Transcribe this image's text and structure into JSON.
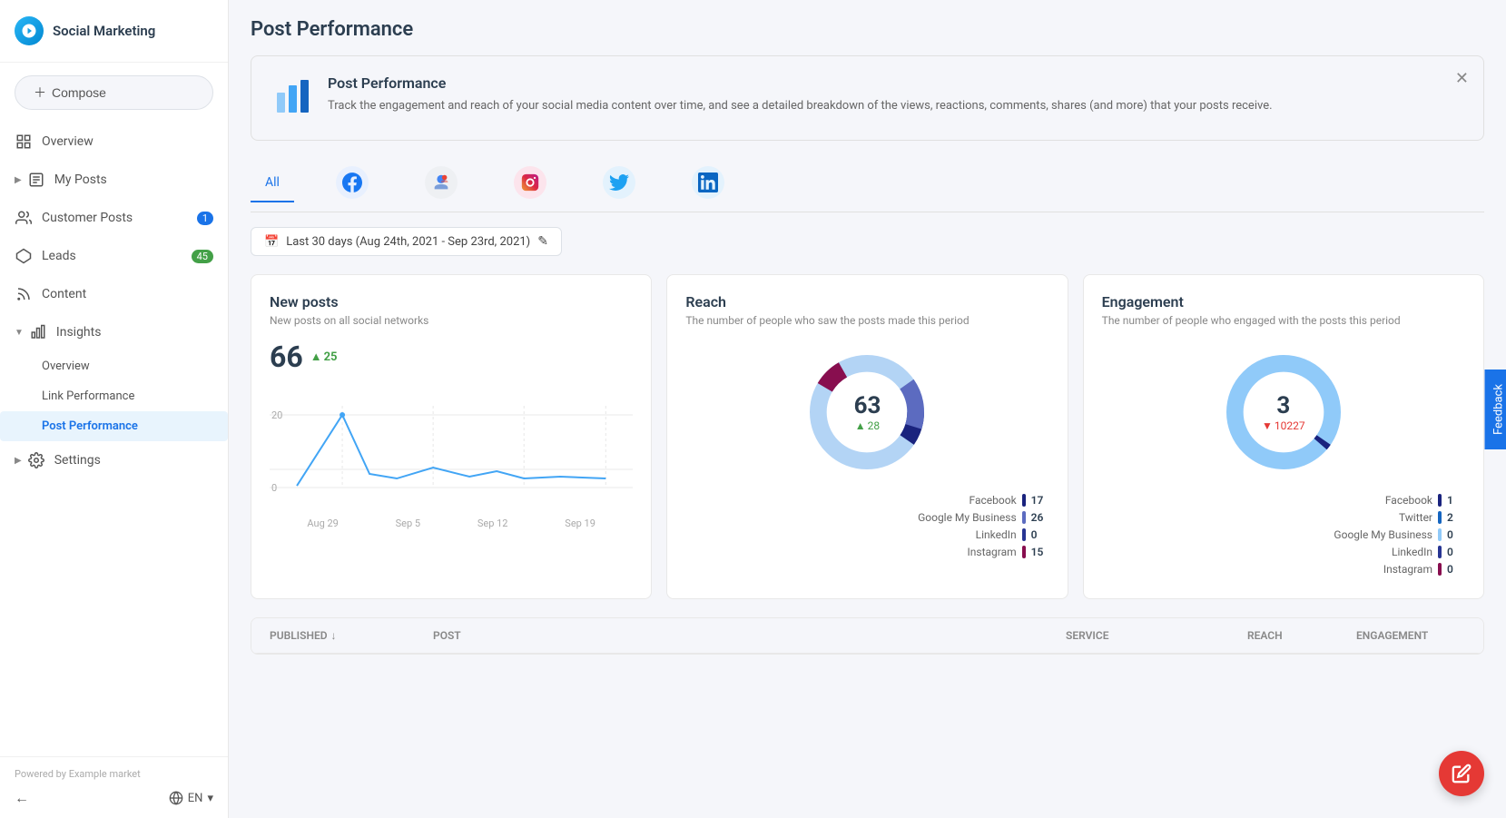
{
  "app": {
    "name": "Social Marketing"
  },
  "compose_button": "Compose",
  "nav": {
    "items": [
      {
        "id": "overview",
        "label": "Overview",
        "icon": "grid-icon",
        "badge": null
      },
      {
        "id": "my-posts",
        "label": "My Posts",
        "icon": "file-text-icon",
        "badge": null,
        "arrow": true
      },
      {
        "id": "customer-posts",
        "label": "Customer Posts",
        "icon": "users-icon",
        "badge": "1",
        "badge_color": "blue"
      },
      {
        "id": "leads",
        "label": "Leads",
        "icon": "hexagon-icon",
        "badge": "45",
        "badge_color": "green"
      },
      {
        "id": "content",
        "label": "Content",
        "icon": "rss-icon",
        "badge": null
      },
      {
        "id": "insights",
        "label": "Insights",
        "icon": "bar-chart-icon",
        "badge": null,
        "expanded": true,
        "arrow": true
      }
    ],
    "sub_items": [
      {
        "id": "insights-overview",
        "label": "Overview"
      },
      {
        "id": "link-performance",
        "label": "Link Performance"
      },
      {
        "id": "post-performance",
        "label": "Post Performance",
        "active": true
      }
    ],
    "settings": {
      "id": "settings",
      "label": "Settings",
      "icon": "gear-icon",
      "arrow": true
    }
  },
  "footer": {
    "powered_by": "Powered by",
    "market": "Example market",
    "lang": "EN"
  },
  "page": {
    "title": "Post Performance",
    "banner": {
      "title": "Post Performance",
      "description": "Track the engagement and reach of your social media content over time, and see a detailed breakdown of the views, reactions, comments, shares (and more) that your posts receive."
    },
    "social_tabs": [
      {
        "id": "all",
        "label": "All",
        "active": true,
        "color": ""
      },
      {
        "id": "facebook",
        "label": "Facebook",
        "color": "#1877F2",
        "bg": "#e8f0fe"
      },
      {
        "id": "google",
        "label": "Google",
        "color": "#5f6368",
        "bg": "#e8eaed"
      },
      {
        "id": "instagram",
        "label": "Instagram",
        "color": "#C13584",
        "bg": "#fce4ec"
      },
      {
        "id": "twitter",
        "label": "Twitter",
        "color": "#1DA1F2",
        "bg": "#e3f2fd"
      },
      {
        "id": "linkedin",
        "label": "LinkedIn",
        "color": "#0A66C2",
        "bg": "#e3f2fd"
      }
    ],
    "date_filter": {
      "label": "Last 30 days (Aug 24th, 2021 - Sep 23rd, 2021)"
    },
    "new_posts": {
      "title": "New posts",
      "subtitle": "New posts on all social networks",
      "value": "66",
      "change": "25",
      "change_dir": "up",
      "y_labels": [
        "20",
        "0"
      ],
      "x_labels": [
        "Aug 29",
        "Sep 5",
        "Sep 12",
        "Sep 19"
      ]
    },
    "reach": {
      "title": "Reach",
      "subtitle": "The number of people who saw the posts made this period",
      "value": "63",
      "change": "28",
      "change_dir": "up",
      "legend": [
        {
          "label": "Facebook",
          "color": "#1a237e",
          "value": "17"
        },
        {
          "label": "Google My Business",
          "color": "#5c6bc0",
          "value": "26"
        },
        {
          "label": "LinkedIn",
          "color": "#283593",
          "value": "0"
        },
        {
          "label": "Instagram",
          "color": "#880e4f",
          "value": "15"
        }
      ]
    },
    "engagement": {
      "title": "Engagement",
      "subtitle": "The number of people who engaged with the posts this period",
      "value": "3",
      "change": "10227",
      "change_dir": "down",
      "legend": [
        {
          "label": "Facebook",
          "color": "#1a237e",
          "value": "1"
        },
        {
          "label": "Twitter",
          "color": "#1565c0",
          "value": "2"
        },
        {
          "label": "Google My Business",
          "color": "#90caf9",
          "value": "0"
        },
        {
          "label": "LinkedIn",
          "color": "#283593",
          "value": "0"
        },
        {
          "label": "Instagram",
          "color": "#880e4f",
          "value": "0"
        }
      ]
    },
    "table": {
      "columns": [
        "Published",
        "Post",
        "Service",
        "Reach",
        "Engagement"
      ]
    }
  }
}
